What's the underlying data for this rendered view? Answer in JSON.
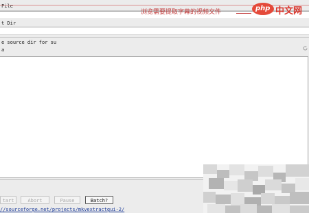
{
  "fields": {
    "video_file_label": "File",
    "output_dir_label": "t Dir",
    "source_dir_label": "e source dir for su"
  },
  "log": {
    "first_line": "a"
  },
  "buttons": {
    "start_label": "tart",
    "abort_label": "Abort",
    "pause_label": "Pause",
    "batch_label": "Batch?"
  },
  "footer": {
    "link_text": "//sourceforge.net/projects/mkvextractgui-2/"
  },
  "overlay": {
    "annotation_text": "浏览需要提取字幕的视频文件",
    "logo_brand": "php",
    "logo_text": "中文网",
    "annotation_color": "#c23b3b",
    "logo_color": "#d9342b"
  }
}
